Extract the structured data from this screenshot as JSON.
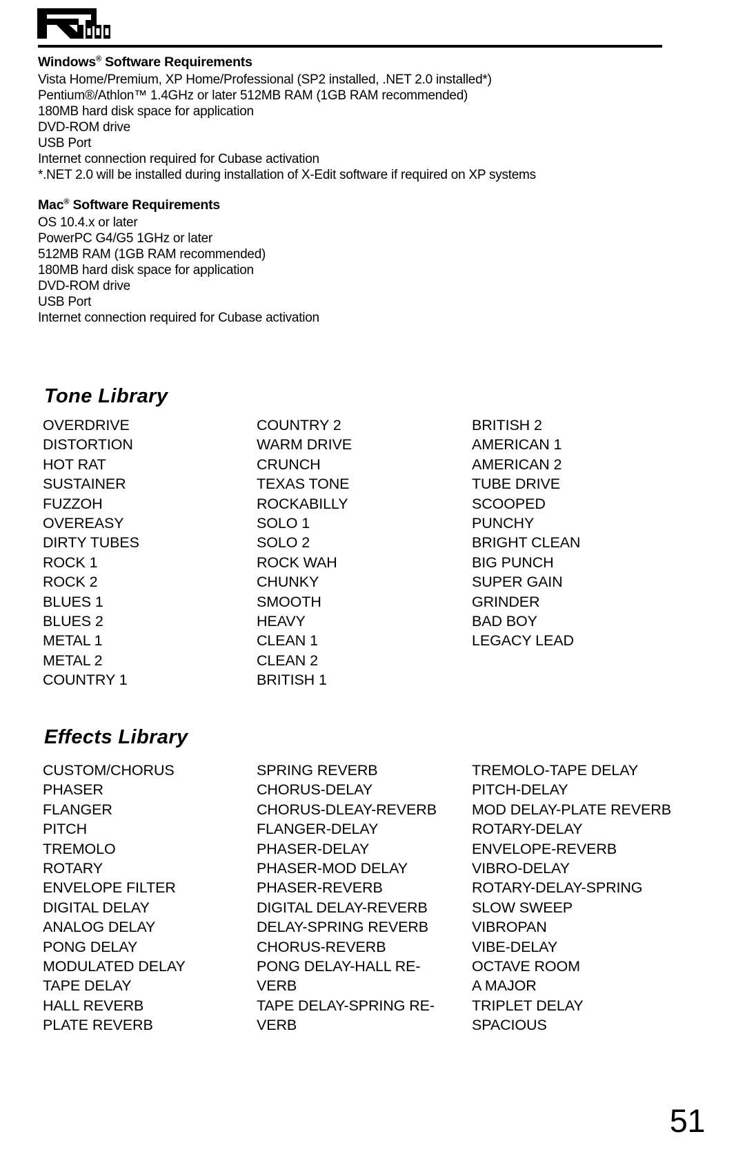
{
  "logo": {
    "brand": "RP",
    "model": "1000",
    "alt": "RP1000"
  },
  "windows_requirements": {
    "heading": "Windows",
    "heading_mark": "®",
    "heading_rest": " Software Requirements",
    "lines": [
      "Vista Home/Premium, XP Home/Professional (SP2 installed, .NET 2.0 installed*)",
      "Pentium®/Athlon™ 1.4GHz or later 512MB RAM (1GB RAM recommended)",
      "180MB hard disk space for application",
      "DVD-ROM drive",
      "USB Port",
      "Internet connection required for Cubase activation",
      "*.NET 2.0 will be installed during installation of X-Edit software if required on XP systems"
    ]
  },
  "mac_requirements": {
    "heading": "Mac",
    "heading_mark": "®",
    "heading_rest": " Software Requirements",
    "lines": [
      "OS 10.4.x or later",
      "PowerPC G4/G5 1GHz or later",
      "512MB RAM (1GB RAM recommended)",
      "180MB hard disk space for application",
      "DVD-ROM drive",
      "USB Port",
      "Internet connection required for Cubase activation"
    ]
  },
  "tone_library": {
    "title": "Tone Library",
    "columns": [
      [
        "OVERDRIVE",
        "DISTORTION",
        "HOT RAT",
        "SUSTAINER",
        "FUZZOH",
        "OVEREASY",
        "DIRTY TUBES",
        "ROCK 1",
        "ROCK 2",
        "BLUES 1",
        "BLUES 2",
        "METAL 1",
        "METAL 2",
        "COUNTRY 1"
      ],
      [
        "COUNTRY 2",
        "WARM DRIVE",
        "CRUNCH",
        "TEXAS TONE",
        "ROCKABILLY",
        "SOLO 1",
        "SOLO 2",
        "ROCK WAH",
        "CHUNKY",
        "SMOOTH",
        "HEAVY",
        "CLEAN 1",
        "CLEAN 2",
        "BRITISH 1"
      ],
      [
        "BRITISH 2",
        "AMERICAN 1",
        "AMERICAN 2",
        "TUBE DRIVE",
        "SCOOPED",
        "PUNCHY",
        "BRIGHT CLEAN",
        "BIG PUNCH",
        "SUPER GAIN",
        "GRINDER",
        "BAD BOY",
        "LEGACY LEAD"
      ]
    ]
  },
  "effects_library": {
    "title": "Effects Library",
    "columns": [
      [
        "CUSTOM/CHORUS",
        "PHASER",
        "FLANGER",
        "PITCH",
        "TREMOLO",
        "ROTARY",
        "ENVELOPE FILTER",
        "DIGITAL DELAY",
        "ANALOG DELAY",
        "PONG DELAY",
        "MODULATED DELAY",
        "TAPE DELAY",
        "HALL REVERB",
        "PLATE REVERB"
      ],
      [
        "SPRING REVERB",
        "CHORUS-DELAY",
        "CHORUS-DLEAY-REVERB",
        "FLANGER-DELAY",
        "PHASER-DELAY",
        "PHASER-MOD DELAY",
        "PHASER-REVERB",
        "DIGITAL DELAY-REVERB",
        "DELAY-SPRING REVERB",
        "CHORUS-REVERB",
        "PONG DELAY-HALL RE-",
        "VERB",
        "TAPE DELAY-SPRING RE-",
        "VERB"
      ],
      [
        "TREMOLO-TAPE DELAY",
        "PITCH-DELAY",
        "MOD DELAY-PLATE REVERB",
        "ROTARY-DELAY",
        "ENVELOPE-REVERB",
        "VIBRO-DELAY",
        "ROTARY-DELAY-SPRING",
        "SLOW SWEEP",
        "VIBROPAN",
        "VIBE-DELAY",
        "OCTAVE ROOM",
        "A MAJOR",
        "TRIPLET DELAY",
        "SPACIOUS"
      ]
    ]
  },
  "page_number": "51"
}
